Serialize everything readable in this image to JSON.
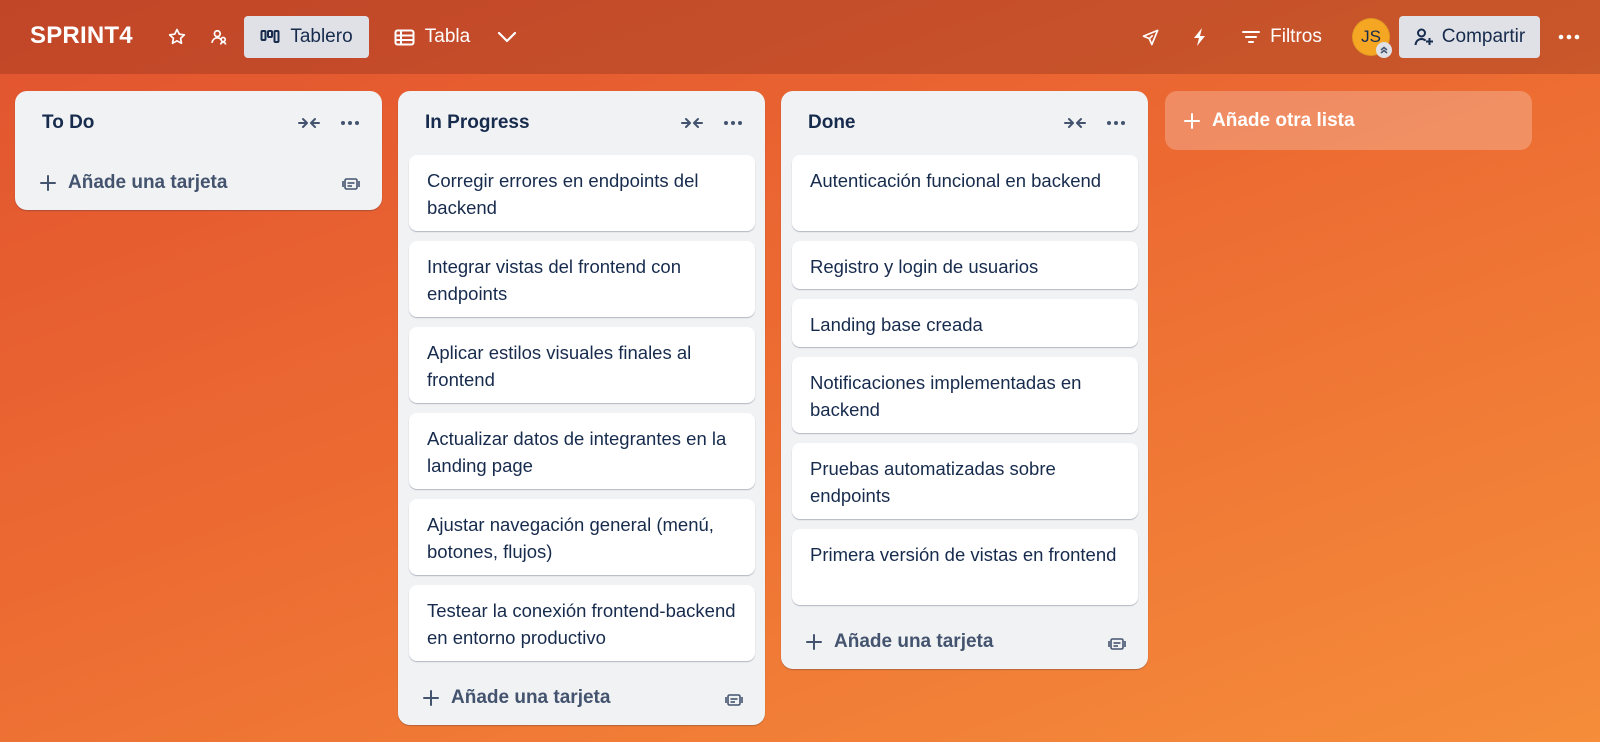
{
  "header": {
    "board_title": "SPRINT4",
    "view_tablero": "Tablero",
    "view_tabla": "Tabla",
    "filters": "Filtros",
    "avatar_initials": "JS",
    "share": "Compartir"
  },
  "lists": [
    {
      "title": "To Do",
      "cards": [],
      "add_card": "Añade una tarjeta"
    },
    {
      "title": "In Progress",
      "cards": [
        "Corregir errores en endpoints del backend",
        "Integrar vistas del frontend con endpoints",
        "Aplicar estilos visuales finales al frontend",
        "Actualizar datos de integrantes en la landing page",
        "Ajustar navegación general (menú, botones, flujos)",
        "Testear la conexión frontend-backend en entorno productivo"
      ],
      "add_card": "Añade una tarjeta"
    },
    {
      "title": "Done",
      "cards": [
        "Autenticación funcional en backend",
        "Registro y login de usuarios",
        "Landing base creada",
        "Notificaciones implementadas en backend",
        "Pruebas automatizadas sobre endpoints",
        "Primera versión de vistas en frontend"
      ],
      "add_card": "Añade una tarjeta"
    }
  ],
  "add_list": "Añade otra lista",
  "icons": {
    "star": "star-icon",
    "workspace": "workspace-visibility-icon",
    "board": "board-icon",
    "table": "table-icon",
    "chevron": "chevron-down-icon",
    "power_ups": "rocket-icon",
    "automation": "lightning-icon",
    "filter": "filter-icon",
    "share": "add-user-icon",
    "more": "more-icon",
    "collapse": "collapse-icon",
    "plus": "plus-icon",
    "template": "template-icon"
  },
  "colors": {
    "background_start": "#e1532f",
    "background_end": "#f58d3a",
    "list_bg": "#f1f2f4",
    "card_bg": "#ffffff",
    "text": "#172b4d",
    "avatar": "#f5a623"
  }
}
